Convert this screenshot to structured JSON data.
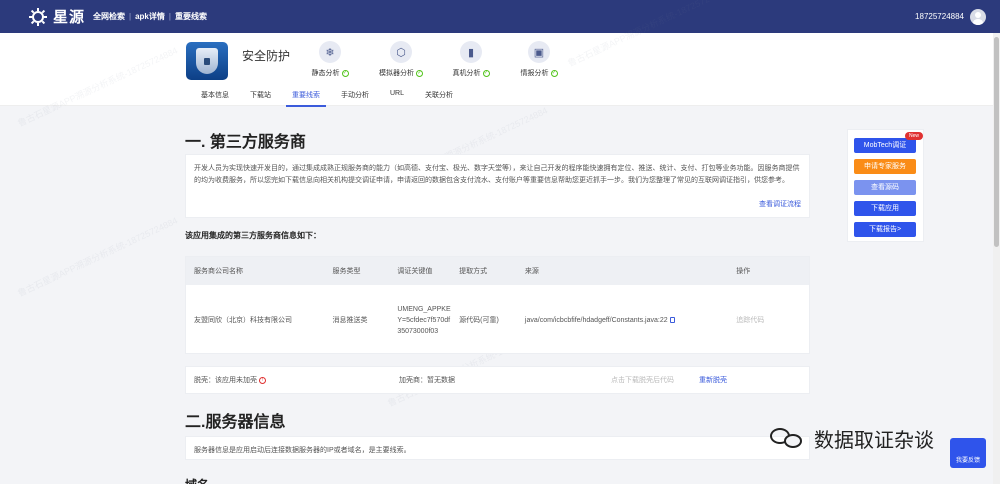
{
  "brand": {
    "name": "星源"
  },
  "nav": {
    "links": [
      "全网检索",
      "apk详情",
      "重要线索"
    ],
    "separator": "|"
  },
  "user": {
    "phone": "18725724884"
  },
  "app": {
    "name": "安全防护"
  },
  "analyses": [
    {
      "label": "静态分析",
      "icon": "snowflake-icon"
    },
    {
      "label": "模拟器分析",
      "icon": "cube-icon"
    },
    {
      "label": "真机分析",
      "icon": "phone-icon"
    },
    {
      "label": "情报分析",
      "icon": "database-icon"
    }
  ],
  "tabs": [
    "基本信息",
    "下载站",
    "重要线索",
    "手动分析",
    "URL",
    "关联分析"
  ],
  "active_tab": "重要线索",
  "section1": {
    "title": "一. 第三方服务商",
    "description": "开发人员为实现快速开发目的，通过集成成熟正规服务商的能力（如高德、支付宝、极光、数字天堂等），来让自己开发的程序能快速拥有定位、推送、统计、支付、打包等业务功能。因服务商提供的均为收费服务，所以您完如下载信息向相关机构提交调证申请，申请返回的数据包含支付流水、支付账户等重要信息帮助您更近抓手一步。我们为您整理了常见的互联网调证指引，供您参考。",
    "guide_link": "查看调证流程",
    "subhead": "该应用集成的第三方服务商信息如下：",
    "table": {
      "headers": [
        "服务商公司名称",
        "服务类型",
        "调证关键值",
        "提取方式",
        "来源",
        "操作"
      ],
      "rows": [
        {
          "company": "友盟同欣（北京）科技有限公司",
          "type": "消息推送类",
          "key": "UMENG_APPKEY=5cfdec7f570df35073000f03",
          "method": "源代码(可靠)",
          "source": "java/com/icbcbfife/hdadgeff/Constants.java:22",
          "action": "追踪代码"
        }
      ]
    },
    "shell": {
      "status_label": "脱壳：该应用未加壳",
      "shelled_label": "加壳商：暂无数据",
      "download_code": "点击下载脱壳后代码",
      "reshell": "重新脱壳"
    }
  },
  "section2": {
    "title": "二.服务器信息",
    "description": "服务器信息是应用启动后连接数据服务器的IP或者域名，是主要线索。",
    "domain_label": "域名"
  },
  "side_panel": {
    "new_badge": "New",
    "buttons": [
      "MobTech调证",
      "申请专家服务",
      "查看源码",
      "下载应用",
      "下载报告>"
    ]
  },
  "wechat_name": "数据取证杂谈",
  "feedback": "我要反馈",
  "watermark": "鲁古石星源APP溯源分析系统-18725724884",
  "colors": {
    "topbar": "#2c3a7c",
    "accent": "#3b5bdb",
    "button_blue": "#2f54eb",
    "button_orange": "#fa8c16"
  }
}
